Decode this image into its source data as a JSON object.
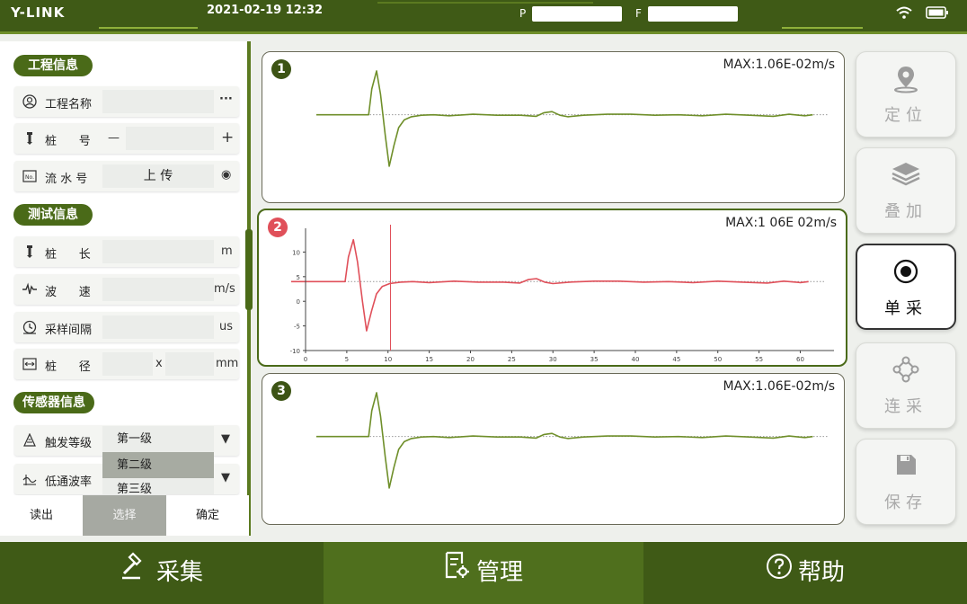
{
  "header": {
    "logo": "Y-LINK",
    "datetime": "2021-02-19   12:32",
    "p_label": "P",
    "f_label": "F"
  },
  "left": {
    "engineering_title": "工程信息",
    "engineering_rows": [
      {
        "label": "工程名称",
        "icon": "user-circle-icon",
        "action": "···"
      },
      {
        "label": "桩      号",
        "prefix": "—",
        "icon": "pile-icon",
        "action": "+"
      },
      {
        "label": "流 水 号",
        "value": "上    传",
        "icon": "number-badge-icon",
        "action": "◉"
      }
    ],
    "test_title": "测试信息",
    "test_rows": [
      {
        "label": "桩      长",
        "unit": "m",
        "icon": "pile-icon"
      },
      {
        "label": "波      速",
        "unit": "m/s",
        "icon": "wave-icon"
      },
      {
        "label": "采样间隔",
        "unit": "us",
        "icon": "clock-icon"
      },
      {
        "label": "桩      径",
        "sep": "x",
        "unit": "mm",
        "icon": "diameter-icon"
      }
    ],
    "sensor_title": "传感器信息",
    "sensor_rows": [
      {
        "label": "触发等级",
        "icon": "trigger-icon"
      },
      {
        "label": "低通波率",
        "icon": "lowpass-icon"
      }
    ],
    "dropdown_options": [
      "第一级",
      "第二级",
      "第三级"
    ],
    "buttons": {
      "read": "读出",
      "select": "选择",
      "confirm": "确定"
    }
  },
  "charts": [
    {
      "number": "1",
      "max_label": "MAX:1.06E-02m/s",
      "color": "#6f8f2a"
    },
    {
      "number": "2",
      "max_label": "MAX:1 06E 02m/s",
      "color": "#e0505a"
    },
    {
      "number": "3",
      "max_label": "MAX:1.06E-02m/s",
      "color": "#6f8f2a"
    }
  ],
  "chart_data": {
    "type": "line",
    "x_ticks": [
      "0",
      "5",
      "10",
      "15",
      "20",
      "25",
      "30",
      "35",
      "40",
      "45",
      "50",
      "55",
      "60"
    ],
    "y_ticks": [
      "10",
      "5",
      "0",
      "-5",
      "-10"
    ],
    "xlim": [
      0,
      63
    ],
    "ylim": [
      -10,
      13
    ],
    "cursor_x": 10.3,
    "series": [
      {
        "x": [
          0,
          4.8,
          5.2,
          5.8,
          6.3,
          6.9,
          7.4,
          8.0,
          8.6,
          9.3,
          10.2,
          11.5,
          13,
          15,
          18,
          21,
          24,
          26,
          27,
          28,
          29,
          30,
          32,
          35,
          38,
          41,
          44,
          47,
          50,
          53,
          56,
          58,
          60,
          61
        ],
        "y": [
          4,
          4,
          9,
          12.5,
          8,
          0,
          -6,
          -2,
          1.5,
          3,
          3.6,
          3.9,
          4.0,
          3.8,
          4.1,
          3.9,
          3.9,
          3.7,
          4.4,
          4.6,
          3.9,
          3.6,
          3.9,
          4.1,
          4.1,
          3.9,
          4.0,
          3.8,
          4.1,
          3.9,
          3.7,
          4.1,
          3.8,
          4.0
        ]
      }
    ]
  },
  "right_buttons": [
    {
      "label": "定位",
      "icon": "location-pin-icon",
      "active": false
    },
    {
      "label": "叠加",
      "icon": "layers-icon",
      "active": false
    },
    {
      "label": "单采",
      "icon": "target-icon",
      "active": true
    },
    {
      "label": "连采",
      "icon": "connect-icon",
      "active": false
    },
    {
      "label": "保存",
      "icon": "save-icon",
      "active": false
    }
  ],
  "bottom_nav": [
    {
      "label": "采集",
      "icon": "hammer-icon"
    },
    {
      "label": "管理",
      "icon": "document-gear-icon"
    },
    {
      "label": "帮助",
      "icon": "help-icon"
    }
  ]
}
